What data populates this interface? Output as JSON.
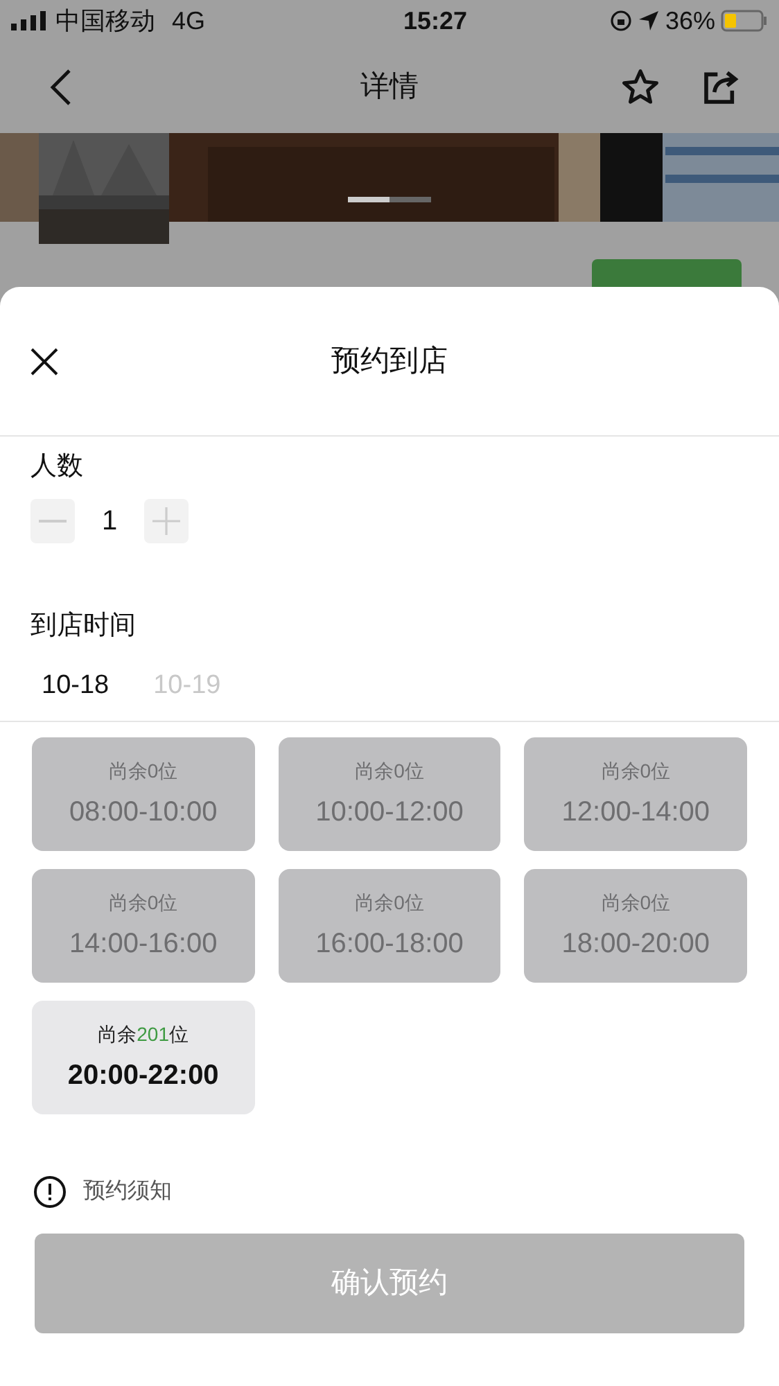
{
  "status_bar": {
    "carrier": "中国移动",
    "network": "4G",
    "time": "15:27",
    "battery": "36%"
  },
  "nav": {
    "title": "详情"
  },
  "sheet": {
    "title": "预约到店",
    "party_label": "人数",
    "party_count": "1",
    "time_label": "到店时间",
    "dates": [
      {
        "label": "10-18",
        "selected": true
      },
      {
        "label": "10-19",
        "selected": false
      }
    ],
    "slots": [
      {
        "remaining_before": "尚余",
        "count": "0",
        "remaining_after": "位",
        "time": "08:00-10:00",
        "available": false
      },
      {
        "remaining_before": "尚余",
        "count": "0",
        "remaining_after": "位",
        "time": "10:00-12:00",
        "available": false
      },
      {
        "remaining_before": "尚余",
        "count": "0",
        "remaining_after": "位",
        "time": "12:00-14:00",
        "available": false
      },
      {
        "remaining_before": "尚余",
        "count": "0",
        "remaining_after": "位",
        "time": "14:00-16:00",
        "available": false
      },
      {
        "remaining_before": "尚余",
        "count": "0",
        "remaining_after": "位",
        "time": "16:00-18:00",
        "available": false
      },
      {
        "remaining_before": "尚余",
        "count": "0",
        "remaining_after": "位",
        "time": "18:00-20:00",
        "available": false
      },
      {
        "remaining_before": "尚余",
        "count": "201",
        "remaining_after": "位",
        "time": "20:00-22:00",
        "available": true
      }
    ],
    "notice": "预约须知",
    "confirm": {
      "label": "确认预约",
      "disabled": true
    }
  }
}
